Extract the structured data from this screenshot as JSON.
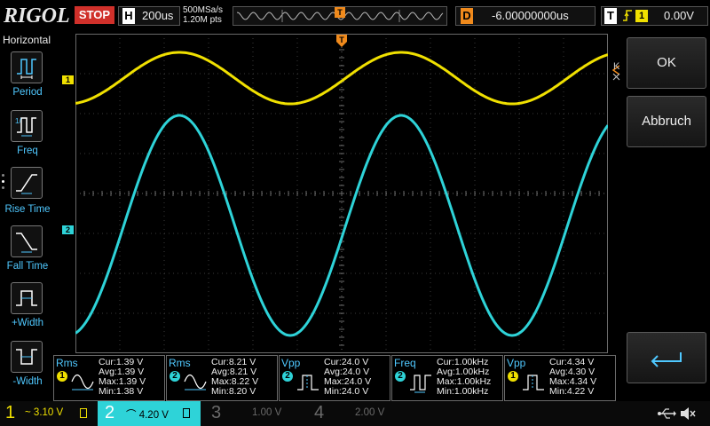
{
  "top_bar": {
    "logo": "RIGOL",
    "run_state": "STOP",
    "timebase_label": "H",
    "timebase_value": "200us",
    "sample_rate": "500MSa/s",
    "memory_depth": "1.20M pts",
    "trigger_position_marker": "T",
    "delay_label": "D",
    "delay_value": "-6.00000000us",
    "trigger_label": "T",
    "trigger_edge": "rising-edge-icon",
    "trigger_source": "1",
    "trigger_level": "0.00V"
  },
  "left_menu": {
    "title": "Horizontal",
    "items": [
      {
        "label": "Period",
        "icon": "period-icon"
      },
      {
        "label": "Freq",
        "icon": "frequency-icon"
      },
      {
        "label": "Rise Time",
        "icon": "rise-time-icon"
      },
      {
        "label": "Fall Time",
        "icon": "fall-time-icon"
      },
      {
        "label": "+Width",
        "icon": "positive-width-icon"
      },
      {
        "label": "-Width",
        "icon": "negative-width-icon"
      }
    ]
  },
  "right_panel": {
    "ok_label": "OK",
    "cancel_label": "Abbruch",
    "enter_icon": "enter-icon",
    "close_icon": "close-icon"
  },
  "channel_markers": [
    {
      "label": "1",
      "color": "#f0e000"
    },
    {
      "label": "2",
      "color": "#2ed3d8"
    }
  ],
  "measurements": [
    {
      "name": "Rms",
      "channel": "1",
      "cur": "Cur:1.39 V",
      "avg": "Avg:1.39 V",
      "max": "Max:1.39 V",
      "min": "Min:1.38 V",
      "icon": "sine-icon",
      "color": "#f0e000"
    },
    {
      "name": "Rms",
      "channel": "2",
      "cur": "Cur:8.21 V",
      "avg": "Avg:8.21 V",
      "max": "Max:8.22 V",
      "min": "Min:8.20 V",
      "icon": "sine-icon",
      "color": "#2ed3d8"
    },
    {
      "name": "Vpp",
      "channel": "2",
      "cur": "Cur:24.0 V",
      "avg": "Avg:24.0 V",
      "max": "Max:24.0 V",
      "min": "Min:24.0 V",
      "icon": "pulse-icon",
      "color": "#2ed3d8"
    },
    {
      "name": "Freq",
      "channel": "2",
      "cur": "Cur:1.00kHz",
      "avg": "Avg:1.00kHz",
      "max": "Max:1.00kHz",
      "min": "Min:1.00kHz",
      "icon": "frequency-icon",
      "color": "#2ed3d8"
    },
    {
      "name": "Vpp",
      "channel": "1",
      "cur": "Cur:4.34 V",
      "avg": "Avg:4.30 V",
      "max": "Max:4.34 V",
      "min": "Min:4.22 V",
      "icon": "pulse-icon",
      "color": "#f0e000"
    }
  ],
  "channels": [
    {
      "number": "1",
      "scale": "3.10 V",
      "color": "#f0e000",
      "active": true
    },
    {
      "number": "2",
      "scale": "4.20 V",
      "color": "#2ed3d8",
      "active": true,
      "selected": true
    },
    {
      "number": "3",
      "scale": "1.00 V",
      "color": "#6a6a6a",
      "active": false
    },
    {
      "number": "4",
      "scale": "2.00 V",
      "color": "#6a6a6a",
      "active": false
    }
  ],
  "status_icons": [
    "usb-icon",
    "sound-muted-icon"
  ]
}
